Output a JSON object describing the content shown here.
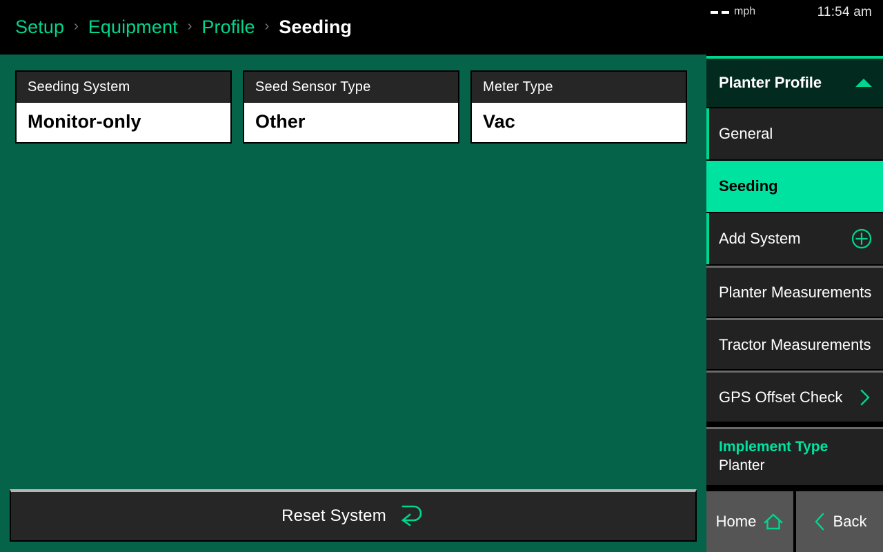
{
  "statusbar": {
    "speed_value": "--",
    "speed_unit": "mph",
    "time": "11:54 am"
  },
  "breadcrumb": {
    "items": [
      {
        "label": "Setup",
        "current": false
      },
      {
        "label": "Equipment",
        "current": false
      },
      {
        "label": "Profile",
        "current": false
      },
      {
        "label": "Seeding",
        "current": true
      }
    ],
    "separator": "›"
  },
  "main": {
    "cards": [
      {
        "label": "Seeding System",
        "value": "Monitor-only"
      },
      {
        "label": "Seed Sensor Type",
        "value": "Other"
      },
      {
        "label": "Meter Type",
        "value": "Vac"
      }
    ],
    "reset_button": {
      "label": "Reset System",
      "icon": "reset-arrow-icon"
    }
  },
  "sidebar": {
    "panel_title": "Planter Profile",
    "panel_caret_icon": "caret-up-icon",
    "items": [
      {
        "label": "General",
        "accent": true,
        "active": false,
        "icon": null,
        "separator": false
      },
      {
        "label": "Seeding",
        "accent": false,
        "active": true,
        "icon": null,
        "separator": false
      },
      {
        "label": "Add System",
        "accent": true,
        "active": false,
        "icon": "plus-circle-icon",
        "separator": false
      },
      {
        "label": "Planter Measurements",
        "accent": false,
        "active": false,
        "icon": null,
        "separator": true
      },
      {
        "label": "Tractor Measurements",
        "accent": false,
        "active": false,
        "icon": null,
        "separator": true
      },
      {
        "label": "GPS Offset Check",
        "accent": false,
        "active": false,
        "icon": "chevron-right-icon",
        "separator": true
      }
    ],
    "info": {
      "label": "Implement Type",
      "value": "Planter"
    },
    "buttons": [
      {
        "label": "Home",
        "icon": "home-icon"
      },
      {
        "label": "Back",
        "icon": "chevron-left-icon"
      }
    ]
  },
  "colors": {
    "accent_teal": "#00D68F",
    "active_teal": "#00E3A0",
    "content_green": "#05634A",
    "panel_dark_green": "#032A1F",
    "nav_dark": "#222222",
    "button_gray": "#555555"
  }
}
